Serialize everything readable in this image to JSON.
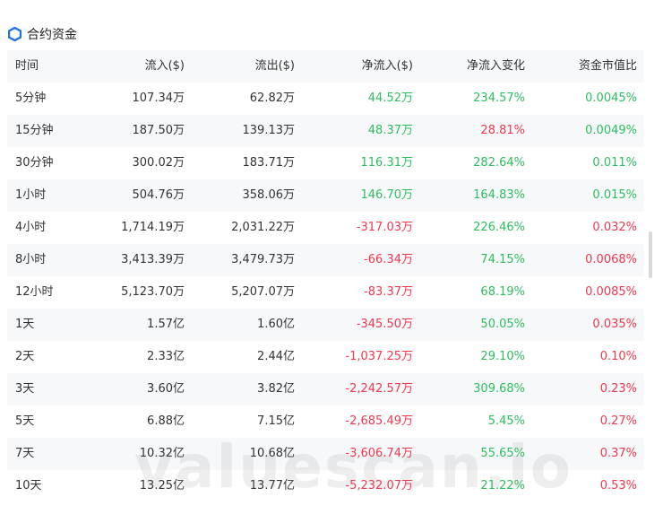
{
  "title": "合约资金",
  "columns": [
    "时间",
    "流入($)",
    "流出($)",
    "净流入($)",
    "净流入变化",
    "资金市值比"
  ],
  "rows": [
    {
      "time": "5分钟",
      "inflow": "107.34万",
      "outflow": "62.82万",
      "net": "44.52万",
      "net_sign": "pos",
      "change": "234.57%",
      "ratio": "0.0045%",
      "ratio_sign": "pos"
    },
    {
      "time": "15分钟",
      "inflow": "187.50万",
      "outflow": "139.13万",
      "net": "48.37万",
      "net_sign": "pos",
      "change": "28.81%",
      "change_sign": "neg",
      "ratio": "0.0049%",
      "ratio_sign": "pos"
    },
    {
      "time": "30分钟",
      "inflow": "300.02万",
      "outflow": "183.71万",
      "net": "116.31万",
      "net_sign": "pos",
      "change": "282.64%",
      "ratio": "0.011%",
      "ratio_sign": "pos"
    },
    {
      "time": "1小时",
      "inflow": "504.76万",
      "outflow": "358.06万",
      "net": "146.70万",
      "net_sign": "pos",
      "change": "164.83%",
      "ratio": "0.015%",
      "ratio_sign": "pos"
    },
    {
      "time": "4小时",
      "inflow": "1,714.19万",
      "outflow": "2,031.22万",
      "net": "-317.03万",
      "net_sign": "neg",
      "change": "226.46%",
      "ratio": "0.032%",
      "ratio_sign": "neg"
    },
    {
      "time": "8小时",
      "inflow": "3,413.39万",
      "outflow": "3,479.73万",
      "net": "-66.34万",
      "net_sign": "neg",
      "change": "74.15%",
      "ratio": "0.0068%",
      "ratio_sign": "neg"
    },
    {
      "time": "12小时",
      "inflow": "5,123.70万",
      "outflow": "5,207.07万",
      "net": "-83.37万",
      "net_sign": "neg",
      "change": "68.19%",
      "ratio": "0.0085%",
      "ratio_sign": "neg"
    },
    {
      "time": "1天",
      "inflow": "1.57亿",
      "outflow": "1.60亿",
      "net": "-345.50万",
      "net_sign": "neg",
      "change": "50.05%",
      "ratio": "0.035%",
      "ratio_sign": "neg"
    },
    {
      "time": "2天",
      "inflow": "2.33亿",
      "outflow": "2.44亿",
      "net": "-1,037.25万",
      "net_sign": "neg",
      "change": "29.10%",
      "ratio": "0.10%",
      "ratio_sign": "neg"
    },
    {
      "time": "3天",
      "inflow": "3.60亿",
      "outflow": "3.82亿",
      "net": "-2,242.57万",
      "net_sign": "neg",
      "change": "309.68%",
      "ratio": "0.23%",
      "ratio_sign": "neg"
    },
    {
      "time": "5天",
      "inflow": "6.88亿",
      "outflow": "7.15亿",
      "net": "-2,685.49万",
      "net_sign": "neg",
      "change": "5.45%",
      "ratio": "0.27%",
      "ratio_sign": "neg"
    },
    {
      "time": "7天",
      "inflow": "10.32亿",
      "outflow": "10.68亿",
      "net": "-3,606.74万",
      "net_sign": "neg",
      "change": "55.65%",
      "ratio": "0.37%",
      "ratio_sign": "neg"
    },
    {
      "time": "10天",
      "inflow": "13.25亿",
      "outflow": "13.77亿",
      "net": "-5,232.07万",
      "net_sign": "neg",
      "change": "21.22%",
      "ratio": "0.53%",
      "ratio_sign": "neg"
    }
  ],
  "watermark": "valuescan.io",
  "colors": {
    "positive": "#2ebd5f",
    "negative": "#f0384f",
    "accent": "#1f6feb"
  },
  "icons": {
    "title_icon": "hexagon-icon"
  }
}
